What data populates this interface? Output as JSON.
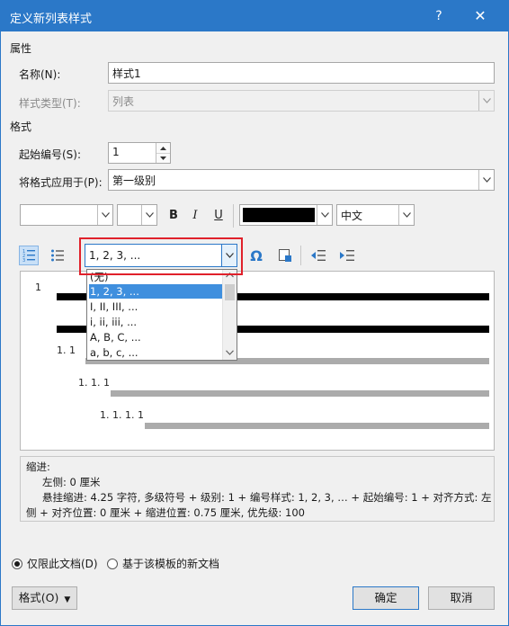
{
  "window": {
    "title": "定义新列表样式",
    "help": "?",
    "close": "✕"
  },
  "properties": {
    "section": "属性",
    "name_label": "名称(N):",
    "name_value": "样式1",
    "type_label": "样式类型(T):",
    "type_value": "列表"
  },
  "format": {
    "section": "格式",
    "start_label": "起始编号(S):",
    "start_value": "1",
    "apply_label": "将格式应用于(P):",
    "apply_value": "第一级别",
    "lang_value": "中文",
    "bold": "B",
    "italic": "I",
    "underline": "U"
  },
  "numbering": {
    "style_value": "1, 2, 3, ...",
    "options": [
      "(无)",
      "1, 2, 3, ...",
      "I, II, III, ...",
      "i, ii, iii, ...",
      "A, B, C, ...",
      "a, b, c, ..."
    ],
    "selected_index": 1,
    "omega": "Ω"
  },
  "preview": {
    "levels": [
      "1",
      "1. 1",
      "1. 1. 1",
      "1. 1. 1. 1"
    ]
  },
  "description": {
    "heading": "缩进:",
    "line1": "左侧:  0 厘米",
    "line2": "悬挂缩进: 4.25 字符, 多级符号 + 级别: 1 + 编号样式: 1, 2, 3, … + 起始编号: 1 + 对齐方式: 左",
    "line3": "侧 + 对齐位置:  0 厘米 + 缩进位置:  0.75 厘米, 优先级: 100"
  },
  "scope": {
    "this_doc": "仅限此文档(D)",
    "template_docs": "基于该模板的新文档"
  },
  "buttons": {
    "format": "格式(O)",
    "ok": "确定",
    "cancel": "取消"
  },
  "colors": {
    "titlebar": "#2b78c8",
    "selection": "#3f8fde",
    "highlight": "#e0212b",
    "font_color": "#000000"
  }
}
